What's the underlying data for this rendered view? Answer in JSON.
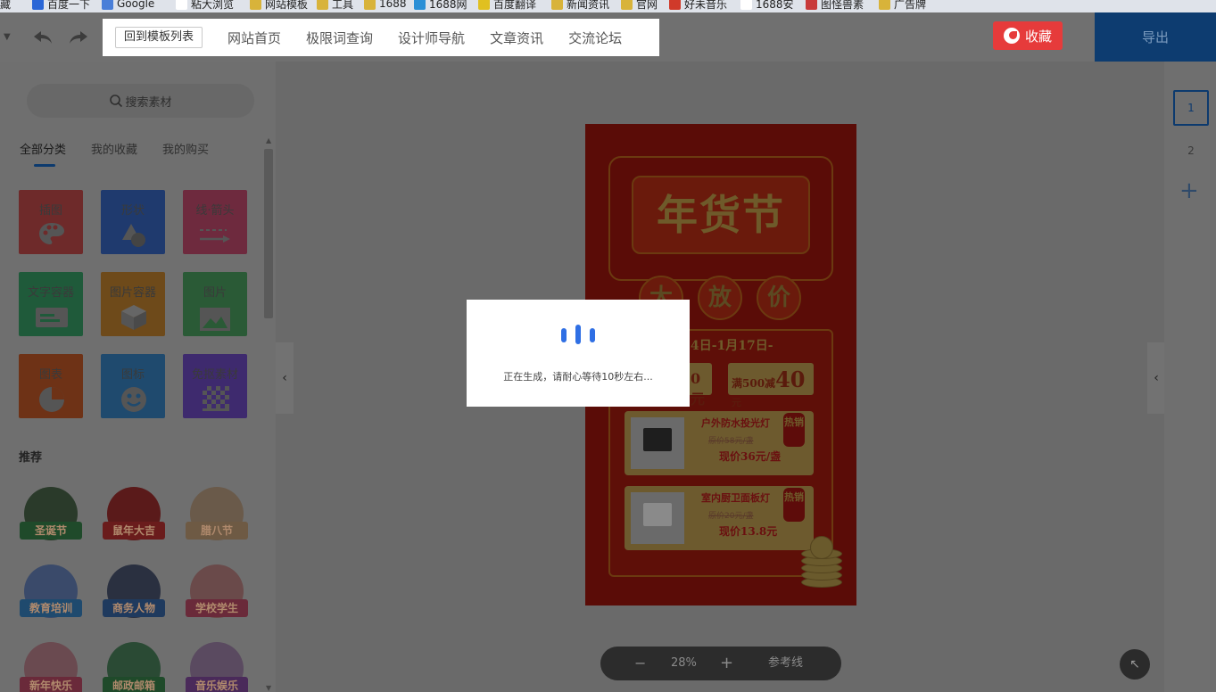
{
  "bookmarks": [
    {
      "label": "藏",
      "color": "#444444"
    },
    {
      "label": "百度一下",
      "color": "#2a66d6"
    },
    {
      "label": "Google",
      "color": "#4a7fd8"
    },
    {
      "label": "粘大浏览",
      "color": "#ffffff"
    },
    {
      "label": "网站模板",
      "color": "#d8b33a"
    },
    {
      "label": "工具",
      "color": "#d8b33a"
    },
    {
      "label": "1688",
      "color": "#d8b33a"
    },
    {
      "label": "1688网",
      "color": "#2a8fd6"
    },
    {
      "label": "百度翻译",
      "color": "#e0c020"
    },
    {
      "label": "新闻资讯",
      "color": "#d8b33a"
    },
    {
      "label": "官网",
      "color": "#d8b33a"
    },
    {
      "label": "好未音乐",
      "color": "#d03a2a"
    },
    {
      "label": "1688安",
      "color": "#ffffff"
    },
    {
      "label": "图怪兽素",
      "color": "#c83a3a"
    },
    {
      "label": "广告牌",
      "color": "#d8b33a"
    }
  ],
  "toolbar": {
    "back_label": "回到模板列表",
    "nav": [
      "网站首页",
      "极限词查询",
      "设计师导航",
      "文章资讯",
      "交流论坛"
    ],
    "favorite_label": "收藏",
    "export_label": "导出"
  },
  "sidebar": {
    "search_placeholder": "搜索素材",
    "tabs": [
      "全部分类",
      "我的收藏",
      "我的购买"
    ],
    "categories": [
      {
        "label": "插图",
        "color": "#6e2a2a"
      },
      {
        "label": "形状",
        "color": "#1f3a6e"
      },
      {
        "label": "线·箭头",
        "color": "#6e2a3e"
      },
      {
        "label": "文字容器",
        "color": "#1f5a3a"
      },
      {
        "label": "图片容器",
        "color": "#6e4a1a"
      },
      {
        "label": "图片",
        "color": "#2a5a36"
      },
      {
        "label": "图表",
        "color": "#6e3216"
      },
      {
        "label": "图标",
        "color": "#1f4a6e"
      },
      {
        "label": "免抠素材",
        "color": "#3e2a6e"
      }
    ],
    "recommend_title": "推荐",
    "stickers": [
      {
        "label": "圣诞节",
        "circle": "#2a3a2a",
        "band": "#1f4a2a"
      },
      {
        "label": "鼠年大吉",
        "circle": "#5a1a1a",
        "band": "#6a1c1c"
      },
      {
        "label": "腊八节",
        "circle": "#6a5a4a",
        "band": "#6e5a44"
      },
      {
        "label": "教育培训",
        "circle": "#3a4a6a",
        "band": "#1f4a6e"
      },
      {
        "label": "商务人物",
        "circle": "#2a3040",
        "band": "#1f3a5e"
      },
      {
        "label": "学校学生",
        "circle": "#6a4a4a",
        "band": "#6a2a3a"
      },
      {
        "label": "新年快乐",
        "circle": "#6a4a50",
        "band": "#6a2a3a"
      },
      {
        "label": "邮政邮箱",
        "circle": "#2a4a34",
        "band": "#1f4a2a"
      },
      {
        "label": "音乐娱乐",
        "circle": "#5a4a60",
        "band": "#4a2a5a"
      }
    ]
  },
  "poster": {
    "title": "年货节",
    "circles": [
      "大",
      "放",
      "价"
    ],
    "date": "4日-1月17日-",
    "coupon_left": "0元",
    "coupon_right_prefix": "满500减",
    "coupon_right_amount": "40",
    "coupon_right_suffix": "元",
    "items": [
      {
        "name": "户外防水投光灯",
        "old": "原价58元/盏",
        "new": "现价36元/盏",
        "hot": "热销"
      },
      {
        "name": "室内厨卫面板灯",
        "old": "原价20元/盏",
        "new": "现价13.8元",
        "hot": "热销"
      }
    ]
  },
  "modal": {
    "message": "正在生成，请耐心等待10秒左右..."
  },
  "pages": {
    "list": [
      "1",
      "2"
    ],
    "active": "1",
    "add_icon": "+"
  },
  "zoom": {
    "minus": "−",
    "value": "28%",
    "plus": "+",
    "guides_label": "参考线"
  },
  "icons": {
    "collapse_left": "‹",
    "collapse_right": "‹",
    "corner": "↖"
  }
}
